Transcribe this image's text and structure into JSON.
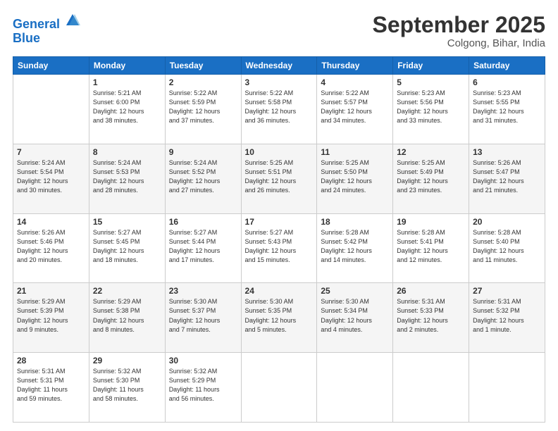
{
  "header": {
    "logo_line1": "General",
    "logo_line2": "Blue",
    "month": "September 2025",
    "location": "Colgong, Bihar, India"
  },
  "days_of_week": [
    "Sunday",
    "Monday",
    "Tuesday",
    "Wednesday",
    "Thursday",
    "Friday",
    "Saturday"
  ],
  "weeks": [
    [
      {
        "day": "",
        "info": ""
      },
      {
        "day": "1",
        "info": "Sunrise: 5:21 AM\nSunset: 6:00 PM\nDaylight: 12 hours\nand 38 minutes."
      },
      {
        "day": "2",
        "info": "Sunrise: 5:22 AM\nSunset: 5:59 PM\nDaylight: 12 hours\nand 37 minutes."
      },
      {
        "day": "3",
        "info": "Sunrise: 5:22 AM\nSunset: 5:58 PM\nDaylight: 12 hours\nand 36 minutes."
      },
      {
        "day": "4",
        "info": "Sunrise: 5:22 AM\nSunset: 5:57 PM\nDaylight: 12 hours\nand 34 minutes."
      },
      {
        "day": "5",
        "info": "Sunrise: 5:23 AM\nSunset: 5:56 PM\nDaylight: 12 hours\nand 33 minutes."
      },
      {
        "day": "6",
        "info": "Sunrise: 5:23 AM\nSunset: 5:55 PM\nDaylight: 12 hours\nand 31 minutes."
      }
    ],
    [
      {
        "day": "7",
        "info": "Sunrise: 5:24 AM\nSunset: 5:54 PM\nDaylight: 12 hours\nand 30 minutes."
      },
      {
        "day": "8",
        "info": "Sunrise: 5:24 AM\nSunset: 5:53 PM\nDaylight: 12 hours\nand 28 minutes."
      },
      {
        "day": "9",
        "info": "Sunrise: 5:24 AM\nSunset: 5:52 PM\nDaylight: 12 hours\nand 27 minutes."
      },
      {
        "day": "10",
        "info": "Sunrise: 5:25 AM\nSunset: 5:51 PM\nDaylight: 12 hours\nand 26 minutes."
      },
      {
        "day": "11",
        "info": "Sunrise: 5:25 AM\nSunset: 5:50 PM\nDaylight: 12 hours\nand 24 minutes."
      },
      {
        "day": "12",
        "info": "Sunrise: 5:25 AM\nSunset: 5:49 PM\nDaylight: 12 hours\nand 23 minutes."
      },
      {
        "day": "13",
        "info": "Sunrise: 5:26 AM\nSunset: 5:47 PM\nDaylight: 12 hours\nand 21 minutes."
      }
    ],
    [
      {
        "day": "14",
        "info": "Sunrise: 5:26 AM\nSunset: 5:46 PM\nDaylight: 12 hours\nand 20 minutes."
      },
      {
        "day": "15",
        "info": "Sunrise: 5:27 AM\nSunset: 5:45 PM\nDaylight: 12 hours\nand 18 minutes."
      },
      {
        "day": "16",
        "info": "Sunrise: 5:27 AM\nSunset: 5:44 PM\nDaylight: 12 hours\nand 17 minutes."
      },
      {
        "day": "17",
        "info": "Sunrise: 5:27 AM\nSunset: 5:43 PM\nDaylight: 12 hours\nand 15 minutes."
      },
      {
        "day": "18",
        "info": "Sunrise: 5:28 AM\nSunset: 5:42 PM\nDaylight: 12 hours\nand 14 minutes."
      },
      {
        "day": "19",
        "info": "Sunrise: 5:28 AM\nSunset: 5:41 PM\nDaylight: 12 hours\nand 12 minutes."
      },
      {
        "day": "20",
        "info": "Sunrise: 5:28 AM\nSunset: 5:40 PM\nDaylight: 12 hours\nand 11 minutes."
      }
    ],
    [
      {
        "day": "21",
        "info": "Sunrise: 5:29 AM\nSunset: 5:39 PM\nDaylight: 12 hours\nand 9 minutes."
      },
      {
        "day": "22",
        "info": "Sunrise: 5:29 AM\nSunset: 5:38 PM\nDaylight: 12 hours\nand 8 minutes."
      },
      {
        "day": "23",
        "info": "Sunrise: 5:30 AM\nSunset: 5:37 PM\nDaylight: 12 hours\nand 7 minutes."
      },
      {
        "day": "24",
        "info": "Sunrise: 5:30 AM\nSunset: 5:35 PM\nDaylight: 12 hours\nand 5 minutes."
      },
      {
        "day": "25",
        "info": "Sunrise: 5:30 AM\nSunset: 5:34 PM\nDaylight: 12 hours\nand 4 minutes."
      },
      {
        "day": "26",
        "info": "Sunrise: 5:31 AM\nSunset: 5:33 PM\nDaylight: 12 hours\nand 2 minutes."
      },
      {
        "day": "27",
        "info": "Sunrise: 5:31 AM\nSunset: 5:32 PM\nDaylight: 12 hours\nand 1 minute."
      }
    ],
    [
      {
        "day": "28",
        "info": "Sunrise: 5:31 AM\nSunset: 5:31 PM\nDaylight: 11 hours\nand 59 minutes."
      },
      {
        "day": "29",
        "info": "Sunrise: 5:32 AM\nSunset: 5:30 PM\nDaylight: 11 hours\nand 58 minutes."
      },
      {
        "day": "30",
        "info": "Sunrise: 5:32 AM\nSunset: 5:29 PM\nDaylight: 11 hours\nand 56 minutes."
      },
      {
        "day": "",
        "info": ""
      },
      {
        "day": "",
        "info": ""
      },
      {
        "day": "",
        "info": ""
      },
      {
        "day": "",
        "info": ""
      }
    ]
  ]
}
